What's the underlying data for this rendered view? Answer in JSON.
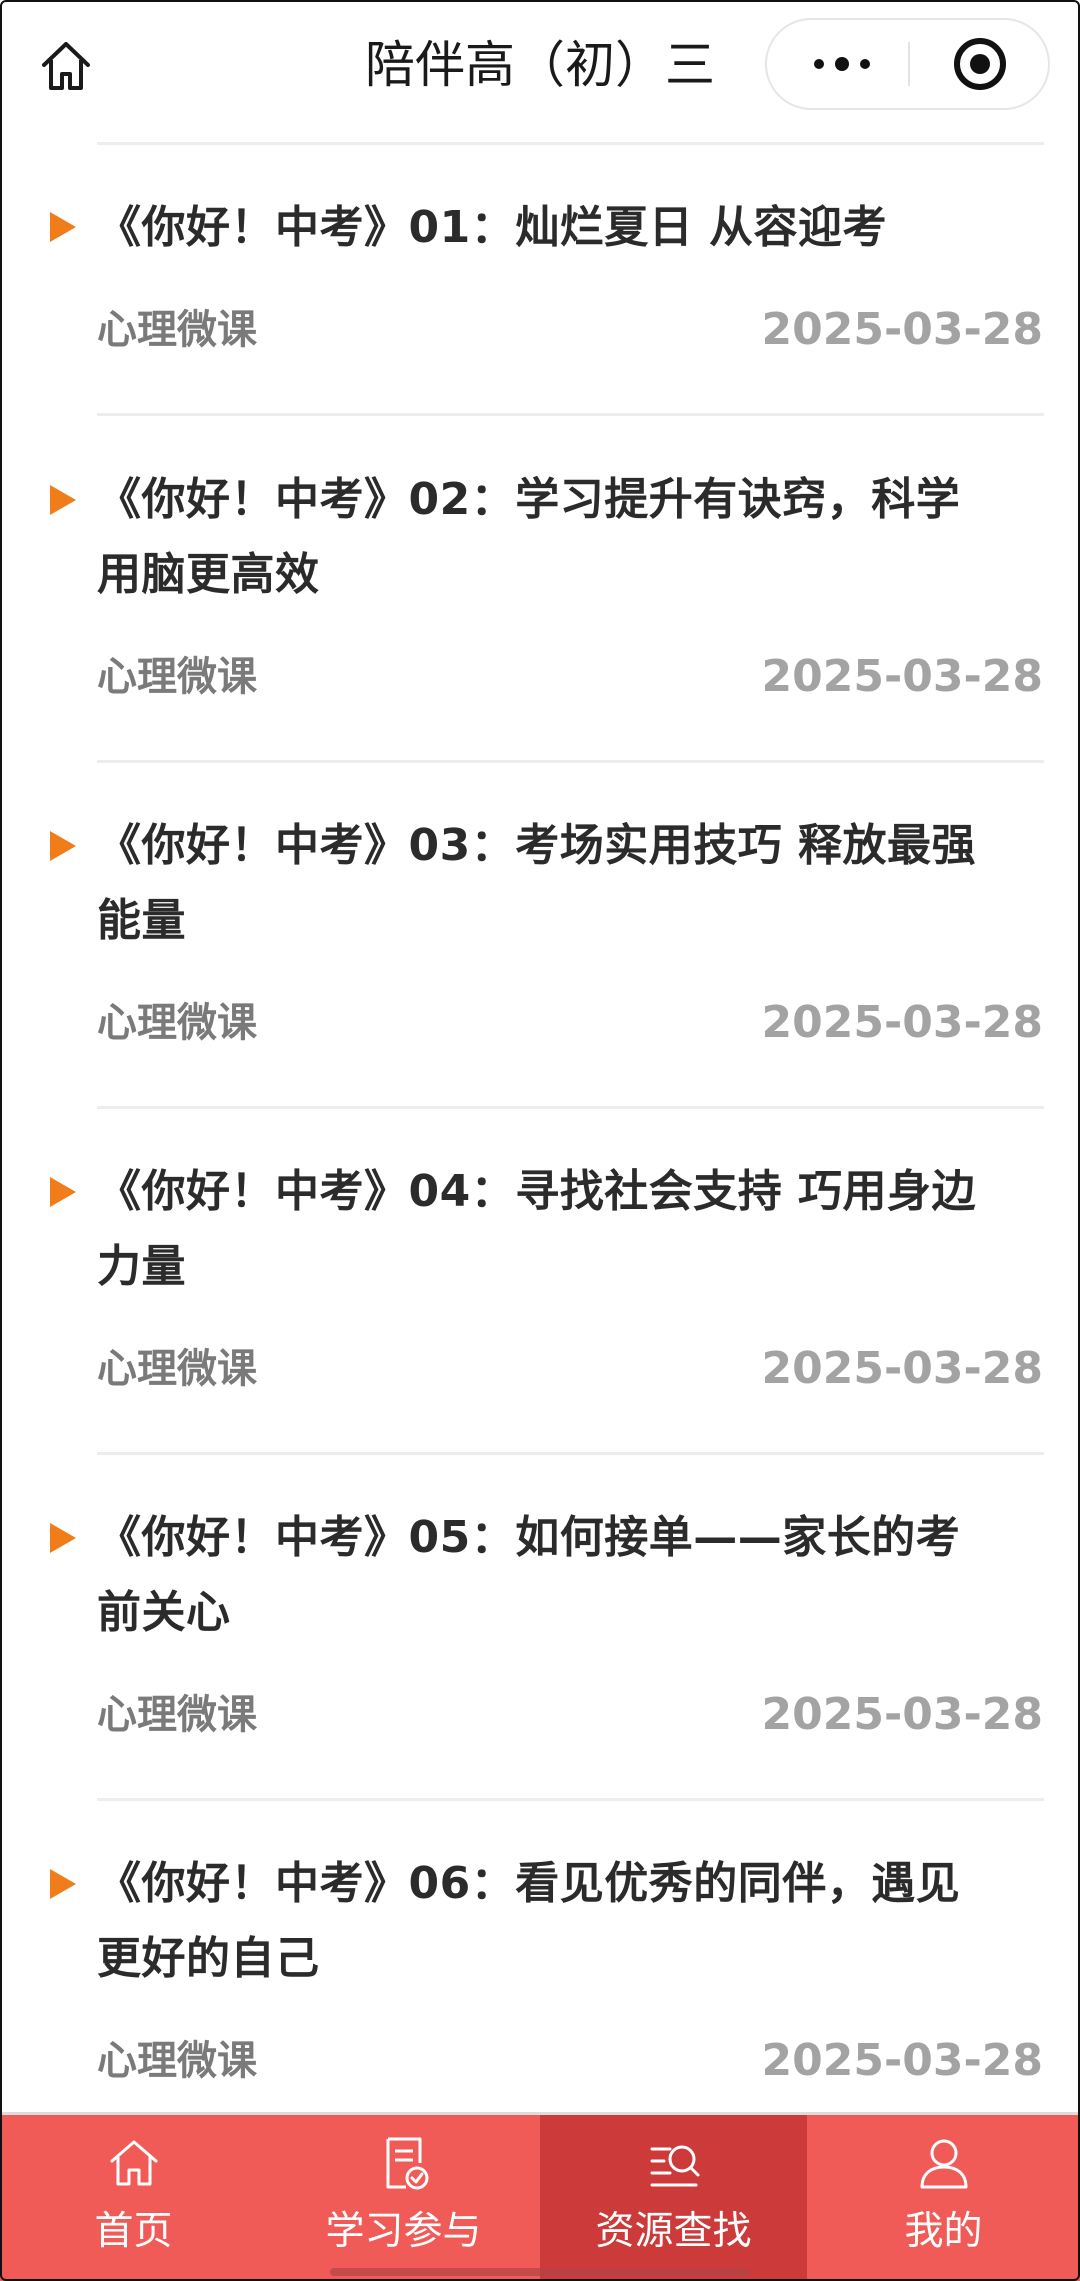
{
  "header": {
    "title": "陪伴高（初）三",
    "home_icon": "home-icon",
    "more_icon": "more-dots-icon",
    "target_icon": "target-circle-icon"
  },
  "list": {
    "items": [
      {
        "title_line1": "《你好！中考》01：灿烂夏日 从容迎考",
        "title_line2": "",
        "category": "心理微课",
        "date": "2025-03-28"
      },
      {
        "title_line1": "《你好！中考》02：学习提升有诀窍，科学",
        "title_line2": "用脑更高效",
        "category": "心理微课",
        "date": "2025-03-28"
      },
      {
        "title_line1": "《你好！中考》03：考场实用技巧 释放最强",
        "title_line2": "能量",
        "category": "心理微课",
        "date": "2025-03-28"
      },
      {
        "title_line1": "《你好！中考》04：寻找社会支持 巧用身边",
        "title_line2": "力量",
        "category": "心理微课",
        "date": "2025-03-28"
      },
      {
        "title_line1": "《你好！中考》05：如何接单——家长的考",
        "title_line2": "前关心",
        "category": "心理微课",
        "date": "2025-03-28"
      },
      {
        "title_line1": "《你好！中考》06：看见优秀的同伴，遇见",
        "title_line2": "更好的自己",
        "category": "心理微课",
        "date": "2025-03-28"
      }
    ]
  },
  "tabbar": {
    "tabs": [
      {
        "label": "首页",
        "icon": "home-icon"
      },
      {
        "label": "学习参与",
        "icon": "document-check-icon"
      },
      {
        "label": "资源查找",
        "icon": "search-list-icon",
        "active": true
      },
      {
        "label": "我的",
        "icon": "user-icon"
      }
    ]
  },
  "colors": {
    "tabbar_bg": "#f15b57",
    "tabbar_active_bg": "#cc3a3a",
    "play_icon": "#f07d1a",
    "date": "#a3a3a3",
    "category": "#7a7a7a"
  }
}
